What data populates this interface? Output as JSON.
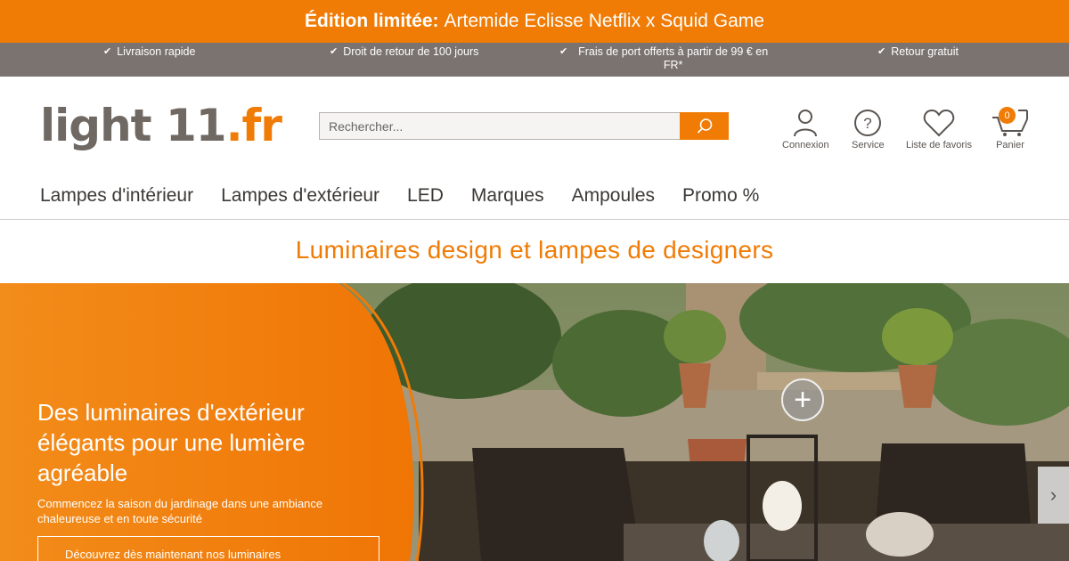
{
  "promo": {
    "bold": "Édition limitée:",
    "text": "Artemide Eclisse Netflix x Squid Game"
  },
  "usps": [
    {
      "label": "Livraison rapide"
    },
    {
      "label": "Droit de retour de 100 jours"
    },
    {
      "label": "Frais de port offerts à partir de 99 € en FR*"
    },
    {
      "label": "Retour gratuit"
    }
  ],
  "logo": {
    "main": "light 11",
    "tld": ".fr"
  },
  "search": {
    "placeholder": "Rechercher..."
  },
  "header_icons": {
    "account": "Connexion",
    "service": "Service",
    "wishlist": "Liste de favoris",
    "cart": "Panier",
    "cart_count": "0"
  },
  "nav": [
    {
      "label": "Lampes d'intérieur"
    },
    {
      "label": "Lampes d'extérieur"
    },
    {
      "label": "LED"
    },
    {
      "label": "Marques"
    },
    {
      "label": "Ampoules"
    },
    {
      "label": "Promo %"
    }
  ],
  "tagline": "Luminaires design et lampes de designers",
  "hero": {
    "title": "Des luminaires d'extérieur élégants pour une lumière agréable",
    "subtitle": "Commencez la saison du jardinage dans une ambiance chaleureuse et en toute sécurité",
    "cta": "Découvrez dès maintenant nos luminaires"
  },
  "colors": {
    "accent": "#f07b05",
    "usp_bar": "#7a7370",
    "text": "#3c3835"
  }
}
